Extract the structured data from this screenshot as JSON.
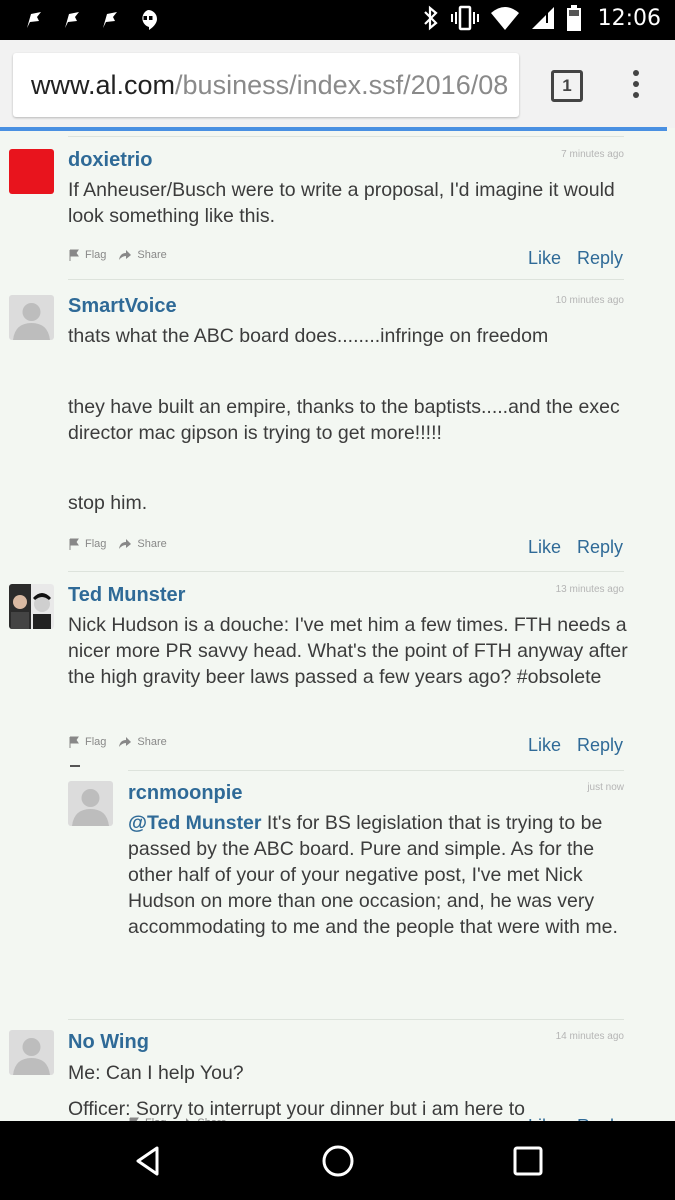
{
  "status_bar": {
    "time": "12:06",
    "left_icons": [
      "flag-notification-icon",
      "flag-notification-icon",
      "flag-notification-icon",
      "hangouts-icon"
    ],
    "right_icons": [
      "bluetooth-icon",
      "vibrate-icon",
      "wifi-icon",
      "cellular-signal-icon",
      "battery-icon"
    ]
  },
  "browser": {
    "url_domain": "www.al.com",
    "url_path": "/business/index.ssf/2016/08",
    "tab_count": "1",
    "menu_icon": "overflow-menu-icon"
  },
  "actions": {
    "flag_label": "Flag",
    "share_label": "Share",
    "like_label": "Like",
    "reply_label": "Reply"
  },
  "comments": [
    {
      "username": "doxietrio",
      "time_ago": "7 minutes ago",
      "avatar": "red-square-avatar",
      "paragraphs": [
        "If Anheuser/Busch were to write a proposal, I'd imagine it would look something like this."
      ]
    },
    {
      "username": "SmartVoice",
      "time_ago": "10 minutes ago",
      "avatar": "default-user-avatar",
      "paragraphs": [
        "thats what the ABC board does........infringe on freedom",
        "they have built an empire, thanks to the baptists.....and the exec director mac gipson is trying to get more!!!!!",
        "stop him."
      ]
    },
    {
      "username": "Ted Munster",
      "time_ago": "13 minutes ago",
      "avatar": "photo-avatar",
      "paragraphs": [
        "Nick Hudson is a douche: I've met him a few times. FTH needs a nicer more PR savvy head. What's the point of FTH anyway after the high gravity beer laws passed a few years ago? #obsolete"
      ]
    },
    {
      "username": "rcnmoonpie",
      "time_ago": "just now",
      "avatar": "default-user-avatar",
      "mention": "@Ted Munster",
      "paragraphs": [
        "It's for BS legislation that is trying to be passed by the ABC board.  Pure and simple.  As for the other half of your of your negative post, I've met Nick Hudson on more than one occasion; and, he was very accommodating to me and the people that were with me."
      ]
    },
    {
      "username": "No Wing",
      "time_ago": "14 minutes ago",
      "avatar": "default-user-avatar",
      "paragraphs": [
        "Me:  Can I help You?",
        "Officer:  Sorry to interrupt your dinner but i am here to"
      ]
    }
  ],
  "nav": {
    "back": "back-triangle-icon",
    "home": "home-circle-icon",
    "recents": "recents-square-icon"
  }
}
